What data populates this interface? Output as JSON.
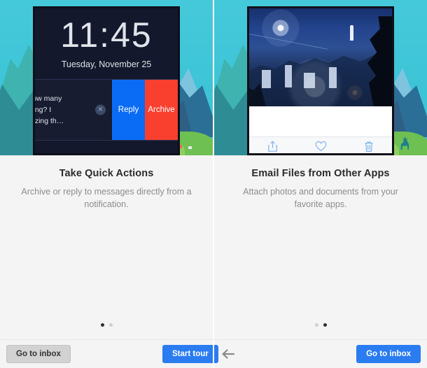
{
  "panels": [
    {
      "id": "take-quick-actions",
      "title": "Take Quick Actions",
      "description": "Archive or reply to messages directly from a notification.",
      "mock": {
        "type": "lockscreen-notification",
        "clock": "11:45",
        "date": "Tuesday, November 25",
        "notification_text": "low many\nring? I\nezing th…",
        "dismiss_icon": "close-x-icon",
        "actions": [
          {
            "label": "Reply",
            "color": "#0a6cf5"
          },
          {
            "label": "Archive",
            "color": "#f93f2e"
          }
        ]
      },
      "dots": {
        "count": 2,
        "active_index": 0
      }
    },
    {
      "id": "email-files-from-other-apps",
      "title": "Email Files from Other Apps",
      "description": "Attach photos and documents from your favorite apps.",
      "mock": {
        "type": "photo-share-sheet",
        "photo_alt": "night-cityscape-photo",
        "toolbar_icons": [
          "share-icon",
          "heart-icon",
          "trash-icon"
        ],
        "toolbar_icon_color": "#7fb3f0"
      },
      "dots": {
        "count": 2,
        "active_index": 1
      }
    }
  ],
  "bottom_bar": {
    "left_button": {
      "label": "Go to inbox",
      "style": "gray"
    },
    "middle_button": {
      "label": "Start tour",
      "style": "blue"
    },
    "back_icon": "arrow-left-icon",
    "right_button": {
      "label": "Go to inbox",
      "style": "blue"
    }
  },
  "colors": {
    "accent_blue": "#2b7cf0",
    "reply_blue": "#0a6cf5",
    "archive_red": "#f93f2e",
    "hero_teal": "#3fc6d8",
    "panel_bg": "#f4f4f4",
    "dot_active": "#2f2f2f",
    "dot_inactive": "#cfcfcf"
  }
}
